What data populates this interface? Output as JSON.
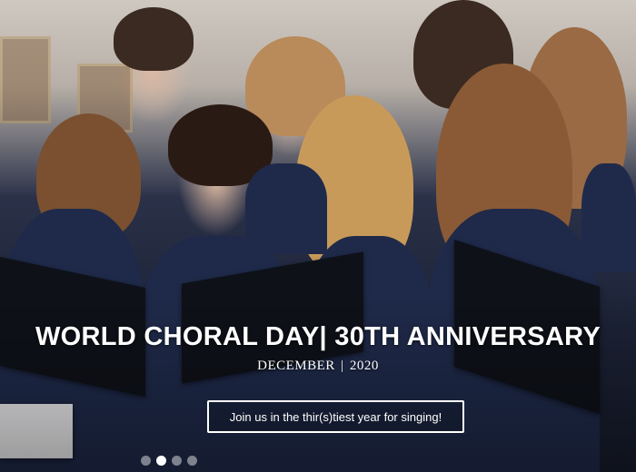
{
  "hero": {
    "title": "WORLD CHORAL DAY| 30TH ANNIVERSARY",
    "subtitle_month": "DECEMBER",
    "subtitle_separator": "|",
    "subtitle_year": "2020",
    "cta_label": "Join us in the thir(s)tiest year for singing!",
    "background_image": "choir-singers-photo"
  },
  "carousel": {
    "slide_count": 4,
    "active_index": 1
  }
}
